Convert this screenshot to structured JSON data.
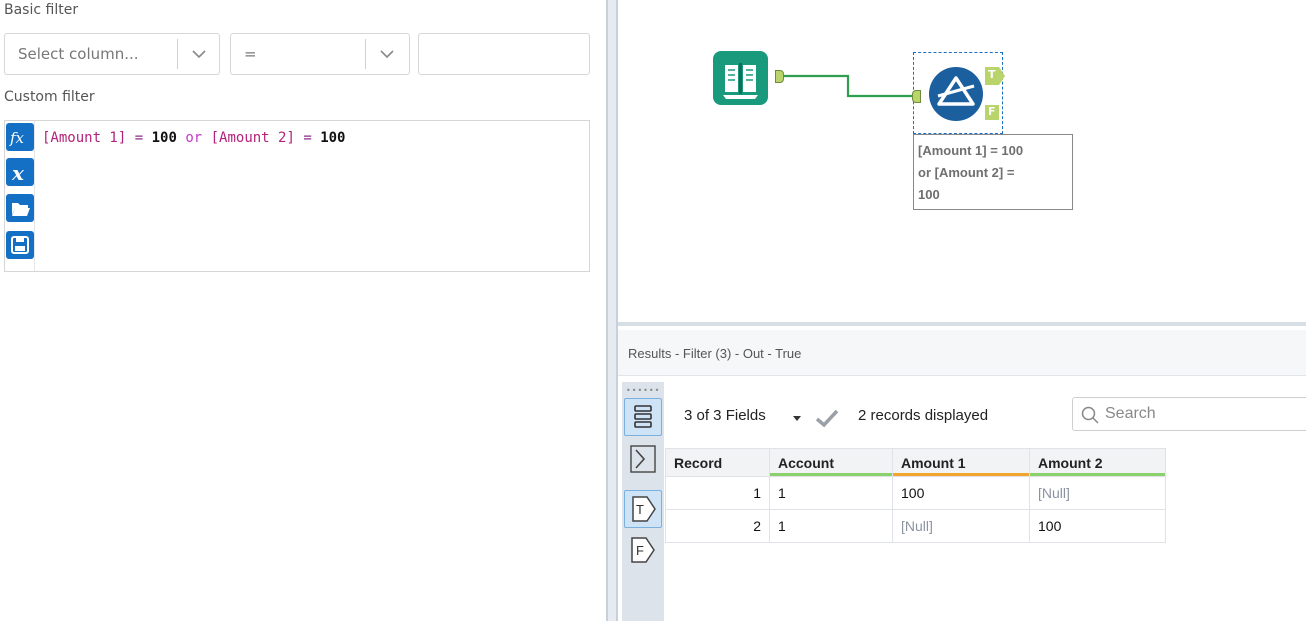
{
  "config": {
    "basic_filter_label": "Basic filter",
    "column_select": {
      "placeholder": "Select column..."
    },
    "operator_select": {
      "value": "="
    },
    "value_input": {
      "value": ""
    },
    "custom_filter_label": "Custom filter",
    "expression": {
      "tokens": [
        {
          "type": "field",
          "text": "[Amount 1]"
        },
        {
          "type": "op",
          "text": " = "
        },
        {
          "type": "num",
          "text": "100"
        },
        {
          "type": "kw",
          "text": " or "
        },
        {
          "type": "field",
          "text": "[Amount 2]"
        },
        {
          "type": "op",
          "text": " = "
        },
        {
          "type": "num",
          "text": "100"
        }
      ]
    },
    "gutter_buttons": [
      {
        "name": "functions",
        "icon": "fx-icon"
      },
      {
        "name": "variables",
        "icon": "variable-x-icon"
      },
      {
        "name": "open",
        "icon": "folder-open-icon"
      },
      {
        "name": "save",
        "icon": "save-icon"
      }
    ]
  },
  "canvas": {
    "filter_tool": {
      "true_anchor": "T",
      "false_anchor": "F",
      "annotation_lines": [
        "[Amount 1] = 100",
        "or [Amount 2] =",
        "100"
      ]
    },
    "connection_color": "#2e9e4f"
  },
  "results": {
    "title": "Results - Filter (3) - Out - True",
    "fields_label": "3 of 3 Fields",
    "records_label": "2 records displayed",
    "search_placeholder": "Search",
    "side_buttons": [
      {
        "name": "table-view",
        "icon": "table-rows-icon",
        "active": true
      },
      {
        "name": "summary",
        "icon": "sigma-icon",
        "active": false
      },
      {
        "name": "true-output",
        "icon": "true-anchor-icon",
        "label": "T",
        "active": true
      },
      {
        "name": "false-output",
        "icon": "false-anchor-icon",
        "label": "F",
        "active": false
      }
    ],
    "columns": [
      "Record",
      "Account",
      "Amount 1",
      "Amount 2"
    ],
    "rows": [
      [
        "1",
        "1",
        "100",
        "[Null]"
      ],
      [
        "2",
        "1",
        "[Null]",
        "100"
      ]
    ]
  },
  "colors": {
    "accent_blue": "#1470c4",
    "input_tool_teal": "#1a9a7d",
    "anchor_green": "#b9d46b",
    "null_grey": "#8b93a1"
  }
}
